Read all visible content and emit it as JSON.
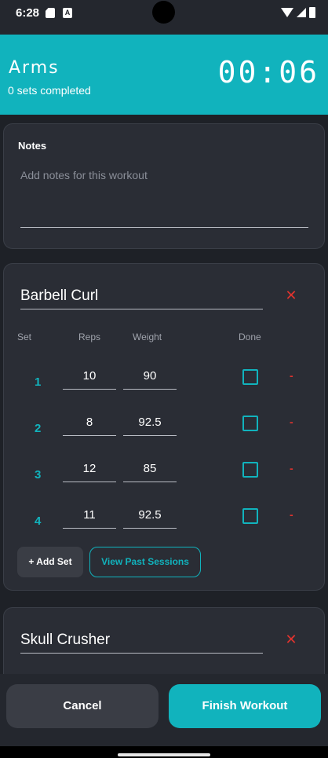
{
  "status_bar": {
    "time": "6:28",
    "a_badge": "A"
  },
  "header": {
    "title": "Arms",
    "subtitle": "0 sets completed",
    "timer": "00:06"
  },
  "notes": {
    "label": "Notes",
    "placeholder": "Add notes for this workout"
  },
  "exercises": [
    {
      "name": "Barbell Curl",
      "columns": {
        "set": "Set",
        "reps": "Reps",
        "weight": "Weight",
        "done": "Done"
      },
      "sets": [
        {
          "set": "1",
          "reps": "10",
          "weight": "90",
          "done": false
        },
        {
          "set": "2",
          "reps": "8",
          "weight": "92.5",
          "done": false
        },
        {
          "set": "3",
          "reps": "12",
          "weight": "85",
          "done": false
        },
        {
          "set": "4",
          "reps": "11",
          "weight": "92.5",
          "done": false
        }
      ],
      "add_set_label": "+ Add Set",
      "past_sessions_label": "View Past Sessions",
      "remove_icon": "close-icon",
      "remove_set_glyph": "-"
    },
    {
      "name": "Skull Crusher",
      "remove_icon": "close-icon"
    }
  ],
  "actions": {
    "cancel_label": "Cancel",
    "finish_label": "Finish Workout"
  },
  "colors": {
    "accent": "#11b3bd",
    "danger": "#e0332e",
    "background": "#1e2127",
    "card": "#2a2d35"
  }
}
